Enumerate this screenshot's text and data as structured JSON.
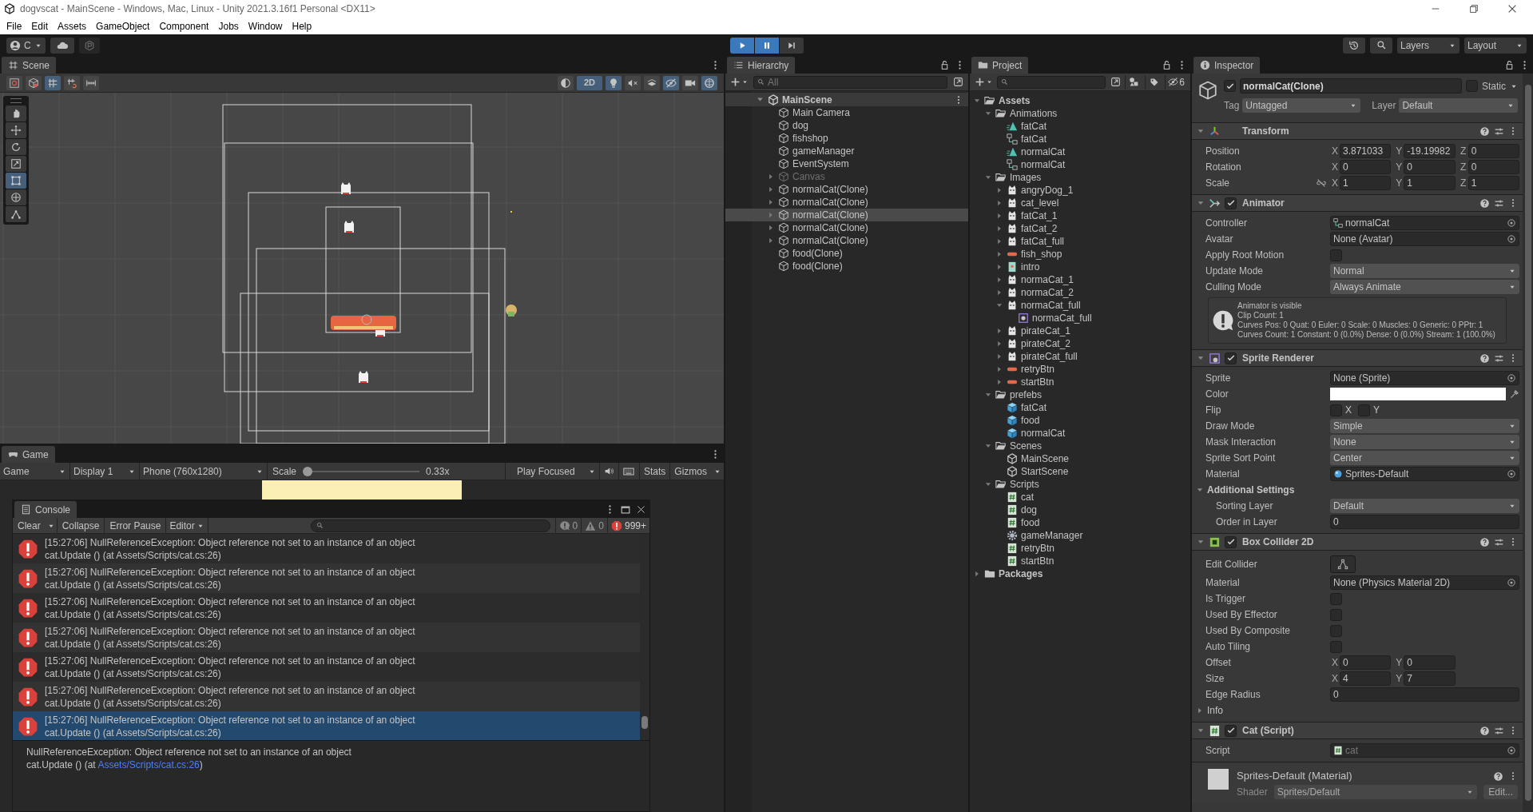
{
  "window": {
    "title": "dogvscat - MainScene - Windows, Mac, Linux - Unity 2021.3.16f1 Personal <DX11>"
  },
  "menu": [
    "File",
    "Edit",
    "Assets",
    "GameObject",
    "Component",
    "Jobs",
    "Window",
    "Help"
  ],
  "toolbar": {
    "account": "C",
    "playing": true,
    "paused": true,
    "layers": "Layers",
    "layout": "Layout"
  },
  "scene": {
    "tab": "Scene",
    "left_toggles": [
      {
        "kind": "draw_mode",
        "selected": false
      },
      {
        "kind": "orientation",
        "selected": false
      },
      {
        "kind": "grid",
        "selected": true
      },
      {
        "kind": "snap",
        "selected": false
      },
      {
        "kind": "ruler",
        "selected": false
      }
    ],
    "right_toggles": [
      {
        "kind": "shading",
        "selected": false
      },
      {
        "kind": "mode_2d",
        "label": "2D",
        "selected": true
      },
      {
        "kind": "light",
        "selected": true
      },
      {
        "kind": "audio",
        "selected": false
      },
      {
        "kind": "effects",
        "selected": false
      },
      {
        "kind": "visibility",
        "selected": true
      },
      {
        "kind": "camera",
        "selected": false
      },
      {
        "kind": "gizmos",
        "selected": true
      }
    ],
    "tools": [
      {
        "kind": "hand",
        "selected": false
      },
      {
        "kind": "move",
        "selected": false
      },
      {
        "kind": "rotate",
        "selected": false
      },
      {
        "kind": "scale",
        "selected": false
      },
      {
        "kind": "rect",
        "selected": true
      },
      {
        "kind": "transform_tool",
        "selected": false
      },
      {
        "kind": "custom",
        "selected": false
      }
    ]
  },
  "game": {
    "tab": "Game",
    "view": "Game",
    "display": "Display 1",
    "aspect": "Phone (760x1280)",
    "scale_label": "Scale",
    "scale_slider": {
      "level": 0
    },
    "scale": "0.33x",
    "play_mode": "Play Focused",
    "stats": "Stats",
    "gizmos": "Gizmos"
  },
  "console": {
    "tab": "Console",
    "buttons": [
      {
        "label": "Clear",
        "kind": "split"
      },
      {
        "label": "Collapse",
        "kind": "toggle",
        "selected": false
      },
      {
        "label": "Error Pause",
        "kind": "toggle",
        "selected": false
      },
      {
        "label": "Editor",
        "kind": "dropdown"
      }
    ],
    "counts": [
      {
        "kind": "log",
        "count": "0"
      },
      {
        "kind": "warning",
        "count": "0"
      },
      {
        "kind": "error",
        "count": "999+"
      }
    ],
    "entries": [
      {
        "message": "[15:27:06] NullReferenceException: Object reference not set to an instance of an object",
        "trace": "cat.Update () (at Assets/Scripts/cat.cs:26)",
        "selected": false
      },
      {
        "message": "[15:27:06] NullReferenceException: Object reference not set to an instance of an object",
        "trace": "cat.Update () (at Assets/Scripts/cat.cs:26)",
        "selected": false
      },
      {
        "message": "[15:27:06] NullReferenceException: Object reference not set to an instance of an object",
        "trace": "cat.Update () (at Assets/Scripts/cat.cs:26)",
        "selected": false
      },
      {
        "message": "[15:27:06] NullReferenceException: Object reference not set to an instance of an object",
        "trace": "cat.Update () (at Assets/Scripts/cat.cs:26)",
        "selected": false
      },
      {
        "message": "[15:27:06] NullReferenceException: Object reference not set to an instance of an object",
        "trace": "cat.Update () (at Assets/Scripts/cat.cs:26)",
        "selected": false
      },
      {
        "message": "[15:27:06] NullReferenceException: Object reference not set to an instance of an object",
        "trace": "cat.Update () (at Assets/Scripts/cat.cs:26)",
        "selected": false
      },
      {
        "message": "[15:27:06] NullReferenceException: Object reference not set to an instance of an object",
        "trace": "cat.Update () (at Assets/Scripts/cat.cs:26)",
        "selected": true
      }
    ],
    "detail": {
      "message": "NullReferenceException: Object reference not set to an instance of an object",
      "trace_prefix": "cat.Update () (at ",
      "link": "Assets/Scripts/cat.cs:26",
      "trace_suffix": ")"
    }
  },
  "hierarchy": {
    "tab": "Hierarchy",
    "search": {
      "placeholder": "All"
    },
    "scene": "MainScene",
    "items": [
      {
        "name": "Main Camera",
        "disabled": false,
        "selected": false
      },
      {
        "name": "dog",
        "disabled": false,
        "selected": false
      },
      {
        "name": "fishshop",
        "disabled": false,
        "selected": false
      },
      {
        "name": "gameManager",
        "disabled": false,
        "selected": false
      },
      {
        "name": "EventSystem",
        "disabled": false,
        "selected": false
      },
      {
        "name": "Canvas",
        "expanded": false,
        "disabled": true,
        "selected": false
      },
      {
        "name": "normalCat(Clone)",
        "expanded": false,
        "disabled": false,
        "selected": false
      },
      {
        "name": "normalCat(Clone)",
        "expanded": false,
        "disabled": false,
        "selected": false
      },
      {
        "name": "normalCat(Clone)",
        "expanded": false,
        "disabled": false,
        "selected": true
      },
      {
        "name": "normalCat(Clone)",
        "expanded": false,
        "disabled": false,
        "selected": false
      },
      {
        "name": "normalCat(Clone)",
        "expanded": false,
        "disabled": false,
        "selected": false
      },
      {
        "name": "food(Clone)",
        "disabled": false,
        "selected": false
      },
      {
        "name": "food(Clone)",
        "disabled": false,
        "selected": false
      }
    ]
  },
  "project": {
    "tab": "Project",
    "hidden_count": "6",
    "items": [
      {
        "name": "Assets",
        "kind": "folder",
        "expanded": true,
        "children": [
          {
            "name": "Animations",
            "kind": "folder",
            "expanded": true,
            "children": [
              {
                "name": "fatCat",
                "kind": "anim"
              },
              {
                "name": "fatCat",
                "kind": "controller"
              },
              {
                "name": "normalCat",
                "kind": "anim"
              },
              {
                "name": "normalCat",
                "kind": "controller"
              }
            ]
          },
          {
            "name": "Images",
            "kind": "folder",
            "expanded": true,
            "children": [
              {
                "name": "angryDog_1",
                "kind": "sprite",
                "expanded": false
              },
              {
                "name": "cat_level",
                "kind": "sprite",
                "expanded": false
              },
              {
                "name": "fatCat_1",
                "kind": "sprite",
                "expanded": false
              },
              {
                "name": "fatCat_2",
                "kind": "sprite",
                "expanded": false
              },
              {
                "name": "fatCat_full",
                "kind": "sprite",
                "expanded": false
              },
              {
                "name": "fish_shop",
                "kind": "bar_sprite",
                "expanded": false
              },
              {
                "name": "intro",
                "kind": "image",
                "expanded": false
              },
              {
                "name": "normaCat_1",
                "kind": "sprite",
                "expanded": false
              },
              {
                "name": "normaCat_2",
                "kind": "sprite",
                "expanded": false
              },
              {
                "name": "normaCat_full",
                "kind": "sprite",
                "expanded": true,
                "children": [
                  {
                    "name": "normaCat_full",
                    "kind": "sprite_sub"
                  }
                ]
              },
              {
                "name": "pirateCat_1",
                "kind": "sprite",
                "expanded": false
              },
              {
                "name": "pirateCat_2",
                "kind": "sprite",
                "expanded": false
              },
              {
                "name": "pirateCat_full",
                "kind": "sprite",
                "expanded": false
              },
              {
                "name": "retryBtn",
                "kind": "bar_sprite",
                "expanded": false
              },
              {
                "name": "startBtn",
                "kind": "bar_sprite",
                "expanded": false
              }
            ]
          },
          {
            "name": "prefebs",
            "kind": "folder",
            "expanded": true,
            "children": [
              {
                "name": "fatCat",
                "kind": "prefab"
              },
              {
                "name": "food",
                "kind": "prefab"
              },
              {
                "name": "normalCat",
                "kind": "prefab"
              }
            ]
          },
          {
            "name": "Scenes",
            "kind": "folder",
            "expanded": true,
            "children": [
              {
                "name": "MainScene",
                "kind": "scene_file"
              },
              {
                "name": "StartScene",
                "kind": "scene_file"
              }
            ]
          },
          {
            "name": "Scripts",
            "kind": "folder",
            "expanded": true,
            "children": [
              {
                "name": "cat",
                "kind": "script"
              },
              {
                "name": "dog",
                "kind": "script"
              },
              {
                "name": "food",
                "kind": "script"
              },
              {
                "name": "gameManager",
                "kind": "gear"
              },
              {
                "name": "retryBtn",
                "kind": "script"
              },
              {
                "name": "startBtn",
                "kind": "script"
              }
            ]
          }
        ]
      },
      {
        "name": "Packages",
        "kind": "folder",
        "expanded": false
      }
    ]
  },
  "inspector": {
    "tab": "Inspector",
    "object": {
      "name": "normalCat(Clone)",
      "active": true,
      "static": false,
      "static_label": "Static",
      "tag_label": "Tag",
      "tag": "Untagged",
      "layer_label": "Layer",
      "layer": "Default"
    },
    "components": [
      {
        "kind": "transform",
        "title": "Transform",
        "fields": [
          {
            "kind": "vector",
            "label": "Position",
            "axes": [
              {
                "axis": "X",
                "value": "3.871033"
              },
              {
                "axis": "Y",
                "value": "-19.19982"
              },
              {
                "axis": "Z",
                "value": "0"
              }
            ]
          },
          {
            "kind": "vector",
            "label": "Rotation",
            "axes": [
              {
                "axis": "X",
                "value": "0"
              },
              {
                "axis": "Y",
                "value": "0"
              },
              {
                "axis": "Z",
                "value": "0"
              }
            ]
          },
          {
            "kind": "vector",
            "label": "Scale",
            "constrained": false,
            "axes": [
              {
                "axis": "X",
                "value": "1"
              },
              {
                "axis": "Y",
                "value": "1"
              },
              {
                "axis": "Z",
                "value": "1"
              }
            ]
          }
        ]
      },
      {
        "kind": "animator",
        "title": "Animator",
        "enabled": true,
        "fields": [
          {
            "kind": "object",
            "label": "Controller",
            "value": "normalCat"
          },
          {
            "kind": "object",
            "label": "Avatar",
            "value": "None (Avatar)"
          },
          {
            "kind": "checkbox",
            "label": "Apply Root Motion",
            "checked": false
          },
          {
            "kind": "dropdown",
            "label": "Update Mode",
            "value": "Normal"
          },
          {
            "kind": "dropdown",
            "label": "Culling Mode",
            "value": "Always Animate"
          },
          {
            "kind": "help",
            "lines": [
              "Animator is visible",
              "Clip Count: 1",
              "Curves Pos: 0 Quat: 0 Euler: 0 Scale: 0 Muscles: 0 Generic: 0 PPtr: 1",
              "Curves Count: 1 Constant: 0 (0.0%) Dense: 0 (0.0%) Stream: 1 (100.0%)"
            ]
          }
        ]
      },
      {
        "kind": "sprite_renderer",
        "title": "Sprite Renderer",
        "enabled": true,
        "fields": [
          {
            "kind": "object",
            "label": "Sprite",
            "value": "None (Sprite)"
          },
          {
            "kind": "color",
            "label": "Color",
            "color": "#ffffff"
          },
          {
            "kind": "flip",
            "label": "Flip",
            "options": [
              {
                "axis": "X",
                "checked": false
              },
              {
                "axis": "Y",
                "checked": false
              }
            ]
          },
          {
            "kind": "dropdown",
            "label": "Draw Mode",
            "value": "Simple"
          },
          {
            "kind": "dropdown",
            "label": "Mask Interaction",
            "value": "None"
          },
          {
            "kind": "dropdown",
            "label": "Sprite Sort Point",
            "value": "Center"
          },
          {
            "kind": "object",
            "label": "Material",
            "value": "Sprites-Default"
          },
          {
            "kind": "foldout",
            "label": "Additional Settings",
            "expanded": true
          },
          {
            "kind": "dropdown",
            "label": "Sorting Layer",
            "value": "Default",
            "indent": true
          },
          {
            "kind": "text",
            "label": "Order in Layer",
            "value": "0",
            "indent": true
          }
        ]
      },
      {
        "kind": "box_collider",
        "title": "Box Collider 2D",
        "enabled": true,
        "fields": [
          {
            "kind": "button",
            "label": "Edit Collider"
          },
          {
            "kind": "object",
            "label": "Material",
            "value": "None (Physics Material 2D)"
          },
          {
            "kind": "checkbox",
            "label": "Is Trigger",
            "checked": false
          },
          {
            "kind": "checkbox",
            "label": "Used By Effector",
            "checked": false
          },
          {
            "kind": "checkbox",
            "label": "Used By Composite",
            "checked": false
          },
          {
            "kind": "checkbox",
            "label": "Auto Tiling",
            "checked": false
          },
          {
            "kind": "vector",
            "label": "Offset",
            "axes": [
              {
                "axis": "X",
                "value": "0"
              },
              {
                "axis": "Y",
                "value": "0"
              }
            ]
          },
          {
            "kind": "vector",
            "label": "Size",
            "axes": [
              {
                "axis": "X",
                "value": "4"
              },
              {
                "axis": "Y",
                "value": "7"
              }
            ]
          },
          {
            "kind": "text",
            "label": "Edge Radius",
            "value": "0"
          },
          {
            "kind": "foldout",
            "label": "Info",
            "expanded": false
          }
        ]
      },
      {
        "kind": "script",
        "title": "Cat (Script)",
        "enabled": true,
        "fields": [
          {
            "kind": "object",
            "label": "Script",
            "value": "cat",
            "disabled": true
          }
        ]
      }
    ],
    "material": {
      "title": "Sprites-Default (Material)",
      "shader_label": "Shader",
      "shader": "Sprites/Default",
      "edit": "Edit..."
    }
  }
}
